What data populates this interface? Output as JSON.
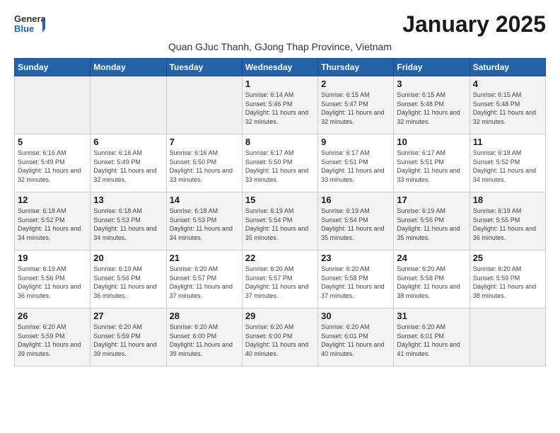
{
  "logo": {
    "general": "General",
    "blue": "Blue"
  },
  "header": {
    "month_title": "January 2025",
    "subtitle": "Quan GJuc Thanh, GJong Thap Province, Vietnam"
  },
  "weekdays": [
    "Sunday",
    "Monday",
    "Tuesday",
    "Wednesday",
    "Thursday",
    "Friday",
    "Saturday"
  ],
  "weeks": [
    [
      {
        "day": "",
        "sunrise": "",
        "sunset": "",
        "daylight": "",
        "empty": true
      },
      {
        "day": "",
        "sunrise": "",
        "sunset": "",
        "daylight": "",
        "empty": true
      },
      {
        "day": "",
        "sunrise": "",
        "sunset": "",
        "daylight": "",
        "empty": true
      },
      {
        "day": "1",
        "sunrise": "Sunrise: 6:14 AM",
        "sunset": "Sunset: 5:46 PM",
        "daylight": "Daylight: 11 hours and 32 minutes."
      },
      {
        "day": "2",
        "sunrise": "Sunrise: 6:15 AM",
        "sunset": "Sunset: 5:47 PM",
        "daylight": "Daylight: 11 hours and 32 minutes."
      },
      {
        "day": "3",
        "sunrise": "Sunrise: 6:15 AM",
        "sunset": "Sunset: 5:48 PM",
        "daylight": "Daylight: 11 hours and 32 minutes."
      },
      {
        "day": "4",
        "sunrise": "Sunrise: 6:15 AM",
        "sunset": "Sunset: 5:48 PM",
        "daylight": "Daylight: 11 hours and 32 minutes."
      }
    ],
    [
      {
        "day": "5",
        "sunrise": "Sunrise: 6:16 AM",
        "sunset": "Sunset: 5:49 PM",
        "daylight": "Daylight: 11 hours and 32 minutes."
      },
      {
        "day": "6",
        "sunrise": "Sunrise: 6:16 AM",
        "sunset": "Sunset: 5:49 PM",
        "daylight": "Daylight: 11 hours and 32 minutes."
      },
      {
        "day": "7",
        "sunrise": "Sunrise: 6:16 AM",
        "sunset": "Sunset: 5:50 PM",
        "daylight": "Daylight: 11 hours and 33 minutes."
      },
      {
        "day": "8",
        "sunrise": "Sunrise: 6:17 AM",
        "sunset": "Sunset: 5:50 PM",
        "daylight": "Daylight: 11 hours and 33 minutes."
      },
      {
        "day": "9",
        "sunrise": "Sunrise: 6:17 AM",
        "sunset": "Sunset: 5:51 PM",
        "daylight": "Daylight: 11 hours and 33 minutes."
      },
      {
        "day": "10",
        "sunrise": "Sunrise: 6:17 AM",
        "sunset": "Sunset: 5:51 PM",
        "daylight": "Daylight: 11 hours and 33 minutes."
      },
      {
        "day": "11",
        "sunrise": "Sunrise: 6:18 AM",
        "sunset": "Sunset: 5:52 PM",
        "daylight": "Daylight: 11 hours and 34 minutes."
      }
    ],
    [
      {
        "day": "12",
        "sunrise": "Sunrise: 6:18 AM",
        "sunset": "Sunset: 5:52 PM",
        "daylight": "Daylight: 11 hours and 34 minutes."
      },
      {
        "day": "13",
        "sunrise": "Sunrise: 6:18 AM",
        "sunset": "Sunset: 5:53 PM",
        "daylight": "Daylight: 11 hours and 34 minutes."
      },
      {
        "day": "14",
        "sunrise": "Sunrise: 6:18 AM",
        "sunset": "Sunset: 5:53 PM",
        "daylight": "Daylight: 11 hours and 34 minutes."
      },
      {
        "day": "15",
        "sunrise": "Sunrise: 6:19 AM",
        "sunset": "Sunset: 5:54 PM",
        "daylight": "Daylight: 11 hours and 35 minutes."
      },
      {
        "day": "16",
        "sunrise": "Sunrise: 6:19 AM",
        "sunset": "Sunset: 5:54 PM",
        "daylight": "Daylight: 11 hours and 35 minutes."
      },
      {
        "day": "17",
        "sunrise": "Sunrise: 6:19 AM",
        "sunset": "Sunset: 5:55 PM",
        "daylight": "Daylight: 11 hours and 35 minutes."
      },
      {
        "day": "18",
        "sunrise": "Sunrise: 6:19 AM",
        "sunset": "Sunset: 5:55 PM",
        "daylight": "Daylight: 11 hours and 36 minutes."
      }
    ],
    [
      {
        "day": "19",
        "sunrise": "Sunrise: 6:19 AM",
        "sunset": "Sunset: 5:56 PM",
        "daylight": "Daylight: 11 hours and 36 minutes."
      },
      {
        "day": "20",
        "sunrise": "Sunrise: 6:19 AM",
        "sunset": "Sunset: 5:56 PM",
        "daylight": "Daylight: 11 hours and 36 minutes."
      },
      {
        "day": "21",
        "sunrise": "Sunrise: 6:20 AM",
        "sunset": "Sunset: 5:57 PM",
        "daylight": "Daylight: 11 hours and 37 minutes."
      },
      {
        "day": "22",
        "sunrise": "Sunrise: 6:20 AM",
        "sunset": "Sunset: 5:57 PM",
        "daylight": "Daylight: 11 hours and 37 minutes."
      },
      {
        "day": "23",
        "sunrise": "Sunrise: 6:20 AM",
        "sunset": "Sunset: 5:58 PM",
        "daylight": "Daylight: 11 hours and 37 minutes."
      },
      {
        "day": "24",
        "sunrise": "Sunrise: 6:20 AM",
        "sunset": "Sunset: 5:58 PM",
        "daylight": "Daylight: 11 hours and 38 minutes."
      },
      {
        "day": "25",
        "sunrise": "Sunrise: 6:20 AM",
        "sunset": "Sunset: 5:59 PM",
        "daylight": "Daylight: 11 hours and 38 minutes."
      }
    ],
    [
      {
        "day": "26",
        "sunrise": "Sunrise: 6:20 AM",
        "sunset": "Sunset: 5:59 PM",
        "daylight": "Daylight: 11 hours and 39 minutes."
      },
      {
        "day": "27",
        "sunrise": "Sunrise: 6:20 AM",
        "sunset": "Sunset: 5:59 PM",
        "daylight": "Daylight: 11 hours and 39 minutes."
      },
      {
        "day": "28",
        "sunrise": "Sunrise: 6:20 AM",
        "sunset": "Sunset: 6:00 PM",
        "daylight": "Daylight: 11 hours and 39 minutes."
      },
      {
        "day": "29",
        "sunrise": "Sunrise: 6:20 AM",
        "sunset": "Sunset: 6:00 PM",
        "daylight": "Daylight: 11 hours and 40 minutes."
      },
      {
        "day": "30",
        "sunrise": "Sunrise: 6:20 AM",
        "sunset": "Sunset: 6:01 PM",
        "daylight": "Daylight: 11 hours and 40 minutes."
      },
      {
        "day": "31",
        "sunrise": "Sunrise: 6:20 AM",
        "sunset": "Sunset: 6:01 PM",
        "daylight": "Daylight: 11 hours and 41 minutes."
      },
      {
        "day": "",
        "sunrise": "",
        "sunset": "",
        "daylight": "",
        "empty": true
      }
    ]
  ]
}
